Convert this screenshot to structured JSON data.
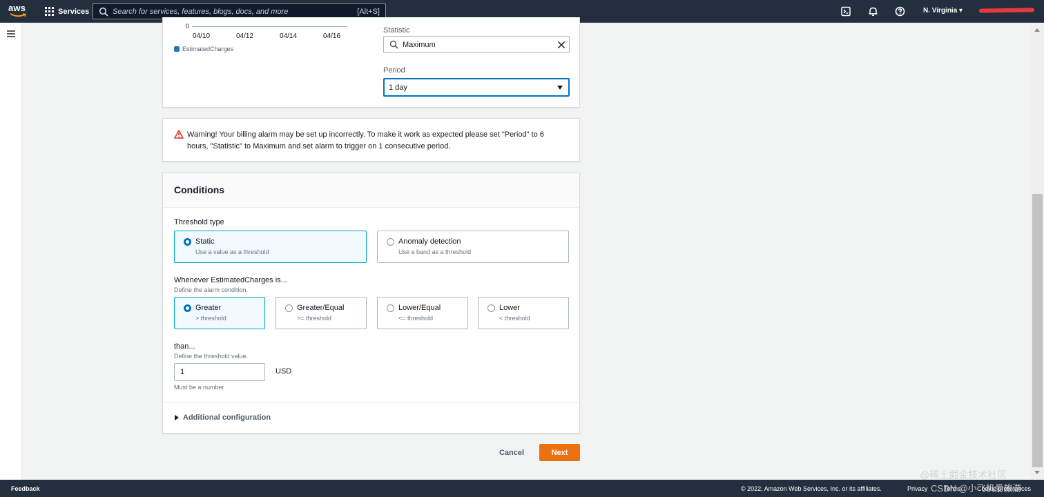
{
  "nav": {
    "logo_text": "aws",
    "services_label": "Services",
    "search_placeholder": "Search for services, features, blogs, docs, and more",
    "search_shortcut": "[Alt+S]",
    "region": "N. Virginia ▾",
    "icons": [
      "cloudshell-icon",
      "bell-icon",
      "help-icon"
    ],
    "account_redacted": true
  },
  "metric": {
    "chart_y_tick": "0",
    "x_ticks": [
      "04/10",
      "04/12",
      "04/14",
      "04/16"
    ],
    "legend": "EstimatedCharges",
    "legend_color": "#1f77b4",
    "statistic_label": "Statistic",
    "statistic_value": "Maximum",
    "period_label": "Period",
    "period_value": "1 day"
  },
  "warning": {
    "text": "Warning! Your billing alarm may be set up incorrectly. To make it work as expected please set \"Period\" to 6 hours, \"Statistic\" to Maximum and set alarm to trigger on 1 consecutive period."
  },
  "conditions": {
    "title": "Conditions",
    "threshold_type_label": "Threshold type",
    "threshold_types": [
      {
        "title": "Static",
        "desc": "Use a value as a threshold",
        "selected": true
      },
      {
        "title": "Anomaly detection",
        "desc": "Use a band as a threshold",
        "selected": false
      }
    ],
    "whenever_label": "Whenever EstimatedCharges is...",
    "whenever_desc": "Define the alarm condition.",
    "operators": [
      {
        "title": "Greater",
        "desc": "> threshold",
        "selected": true
      },
      {
        "title": "Greater/Equal",
        "desc": ">= threshold",
        "selected": false
      },
      {
        "title": "Lower/Equal",
        "desc": "<= threshold",
        "selected": false
      },
      {
        "title": "Lower",
        "desc": "< threshold",
        "selected": false
      }
    ],
    "than_label": "than...",
    "than_desc": "Define the threshold value.",
    "threshold_value": "1",
    "unit": "USD",
    "hint": "Must be a number",
    "additional_config": "Additional configuration"
  },
  "actions": {
    "cancel": "Cancel",
    "next": "Next"
  },
  "footer": {
    "feedback": "Feedback",
    "copyright": "© 2022, Amazon Web Services, Inc. or its affiliates.",
    "privacy": "Privacy",
    "terms": "Terms",
    "cookie": "Cookie preferences"
  },
  "watermark": {
    "line1": "@稀土掘金技术社区",
    "line2": "CSDN @小飞机爱旅游"
  },
  "colors": {
    "nav_bg": "#232f3e",
    "accent_blue": "#0073bb",
    "next_orange": "#ec7211",
    "warning_red": "#d13212"
  }
}
